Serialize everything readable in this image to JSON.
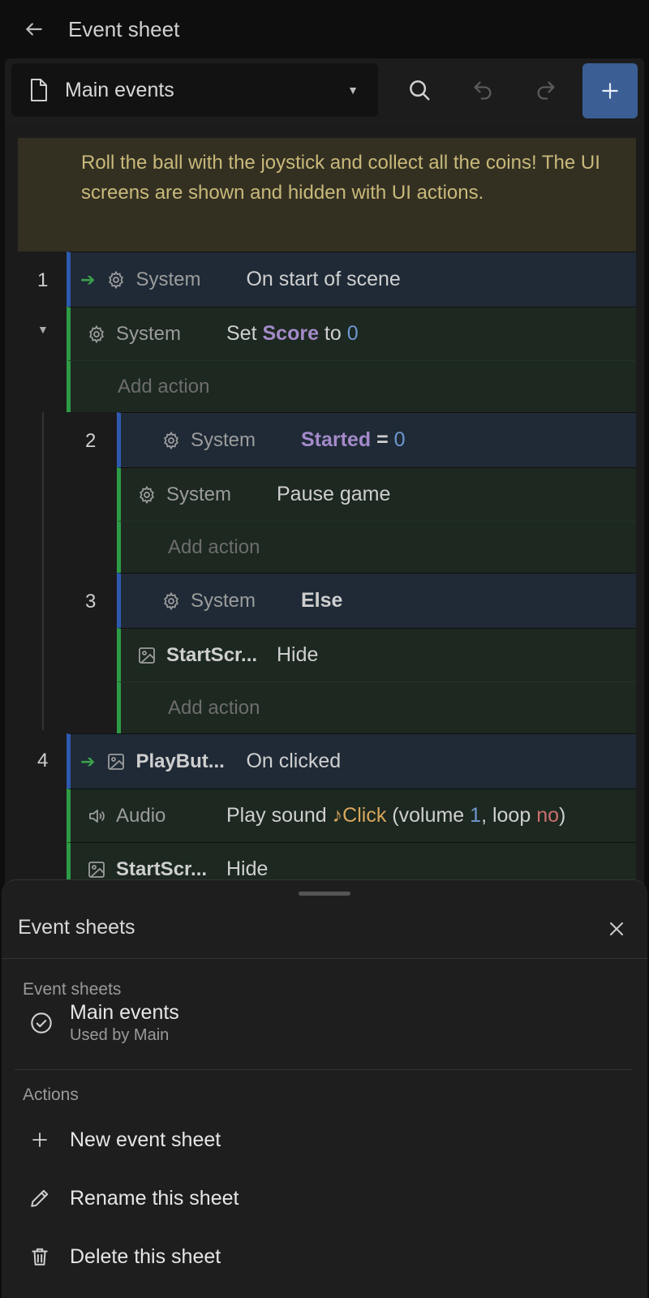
{
  "header": {
    "title": "Event sheet",
    "back_icon": "arrow-left-icon"
  },
  "toolbar": {
    "selected_sheet": "Main events",
    "icons": {
      "document": "document-icon",
      "search": "search-icon",
      "undo": "undo-icon",
      "redo": "redo-icon",
      "add": "plus-icon"
    },
    "colors": {
      "add_button": "#3b5f95"
    }
  },
  "comment": {
    "text": "Roll the ball with the joystick and collect all the coins! The UI screens are shown and hidden with UI actions.",
    "color": "#c9b97a"
  },
  "events": [
    {
      "number": "1",
      "condition": {
        "object": "System",
        "text": "On start of scene",
        "trigger": true
      },
      "actions": [
        {
          "object": "System",
          "parts": [
            "Set",
            "Score",
            "to",
            "0"
          ]
        }
      ],
      "add_action": "Add action"
    },
    {
      "number": "2",
      "condition": {
        "object": "System",
        "variable": "Started",
        "operator": "=",
        "value": "0"
      },
      "actions": [
        {
          "object": "System",
          "text": "Pause game"
        }
      ],
      "add_action": "Add action"
    },
    {
      "number": "3",
      "condition": {
        "object": "System",
        "text": "Else"
      },
      "actions": [
        {
          "object": "StartScr...",
          "text": "Hide"
        }
      ],
      "add_action": "Add action"
    },
    {
      "number": "4",
      "condition": {
        "object": "PlayBut...",
        "text": "On clicked",
        "trigger": true
      },
      "actions": [
        {
          "object": "Audio",
          "parts": [
            "Play sound",
            "♪",
            "Click",
            "(volume",
            "1",
            ", loop",
            "no",
            ")"
          ]
        },
        {
          "object": "StartScr...",
          "text": "Hide"
        }
      ]
    }
  ],
  "bottom_sheet": {
    "title": "Event sheets",
    "close_icon": "close-icon",
    "sections": {
      "sheets_label": "Event sheets",
      "actions_label": "Actions"
    },
    "current_sheet": {
      "name": "Main events",
      "subtitle": "Used by Main",
      "icon": "check-circle-icon"
    },
    "actions": [
      {
        "label": "New event sheet",
        "icon": "plus-icon"
      },
      {
        "label": "Rename this sheet",
        "icon": "pencil-icon"
      },
      {
        "label": "Delete this sheet",
        "icon": "trash-icon"
      }
    ]
  }
}
